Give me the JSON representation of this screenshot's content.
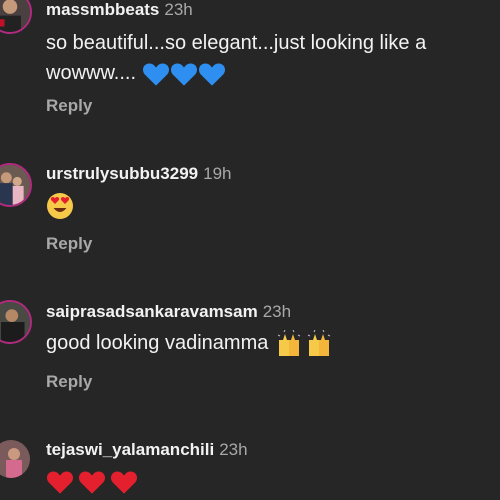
{
  "comments": [
    {
      "username": "massmbbeats",
      "time": "23h",
      "line1": "so beautiful...so elegant...just looking like a",
      "line2_text": "wowww....",
      "line2_emoji": [
        "blue-heart",
        "blue-heart",
        "blue-heart"
      ],
      "reply": "Reply"
    },
    {
      "username": "urstrulysubbu3299",
      "time": "19h",
      "emoji": [
        "heart-eyes"
      ],
      "reply": "Reply"
    },
    {
      "username": "saiprasadsankaravamsam",
      "time": "23h",
      "line1": "good looking vadinamma",
      "line1_emoji": [
        "raising-hands",
        "raising-hands"
      ],
      "reply": "Reply"
    },
    {
      "username": "tejaswi_yalamanchili",
      "time": "23h",
      "emoji": [
        "red-heart",
        "red-heart",
        "red-heart"
      ]
    }
  ],
  "colors": {
    "background": "#262626",
    "text": "#f2f2f2",
    "muted": "#a8a8a8",
    "story_ring": "#b12a7f",
    "blue_heart": "#2f8ff0",
    "red_heart": "#e4202f"
  }
}
